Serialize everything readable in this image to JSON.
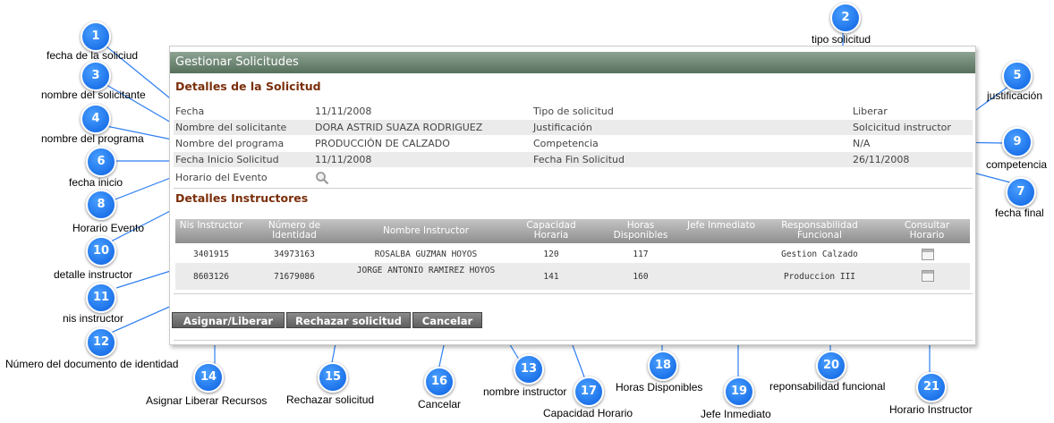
{
  "panel": {
    "title": "Gestionar Solicitudes",
    "request_section": "Detalles de la Solicitud",
    "fields": {
      "fecha_label": "Fecha",
      "fecha_value": "11/11/2008",
      "tipo_label": "Tipo de solicitud",
      "tipo_value": "Liberar",
      "nombre_label": "Nombre del solicitante",
      "nombre_value": "DORA ASTRID SUAZA RODRIGUEZ",
      "justificacion_label": "Justificación",
      "justificacion_value": "Solcicitud instructor",
      "programa_label": "Nombre del programa",
      "programa_value": "PRODUCCIÓN DE CALZADO",
      "competencia_label": "Competencia",
      "competencia_value": "N/A",
      "inicio_label": "Fecha Inicio Solicitud",
      "inicio_value": "11/11/2008",
      "fin_label": "Fecha Fin Solicitud",
      "fin_value": "26/11/2008",
      "horario_label": "Horario del Evento"
    },
    "instructors_section": "Detalles Instructores",
    "table": {
      "headers": [
        "Nis Instructor",
        "Número de Identidad",
        "Nombre Instructor",
        "Capacidad Horaria",
        "Horas Disponibles",
        "Jefe Inmediato",
        "Responsabilidad Funcional",
        "Consultar Horario"
      ],
      "rows": [
        {
          "nis": "3401915",
          "id": "34973163",
          "name": "ROSALBA GUZMAN HOYOS",
          "cap": "120",
          "horas": "117",
          "jefe": "",
          "resp": "Gestion Calzado"
        },
        {
          "nis": "8603126",
          "id": "71679086",
          "name": "JORGE ANTONIO RAMIREZ HOYOS",
          "cap": "141",
          "horas": "160",
          "jefe": "",
          "resp": "Produccion III"
        }
      ]
    },
    "buttons": {
      "assign": "Asignar/Liberar",
      "reject": "Rechazar solicitud",
      "cancel": "Cancelar"
    }
  },
  "callouts": [
    {
      "n": "1",
      "label": "fecha de la soliciud"
    },
    {
      "n": "2",
      "label": "tipo solicitud"
    },
    {
      "n": "3",
      "label": "nombre del solicitante"
    },
    {
      "n": "4",
      "label": "nombre del programa"
    },
    {
      "n": "5",
      "label": "justificación"
    },
    {
      "n": "6",
      "label": "fecha inicio"
    },
    {
      "n": "7",
      "label": "fecha final"
    },
    {
      "n": "8",
      "label": "Horario Evento"
    },
    {
      "n": "9",
      "label": "competencia"
    },
    {
      "n": "10",
      "label": "detalle instructor"
    },
    {
      "n": "11",
      "label": "nis instructor"
    },
    {
      "n": "12",
      "label": "Número del documento de identidad"
    },
    {
      "n": "13",
      "label": "nombre instructor"
    },
    {
      "n": "14",
      "label": "Asignar Liberar Recursos"
    },
    {
      "n": "15",
      "label": "Rechazar solicitud"
    },
    {
      "n": "16",
      "label": "Cancelar"
    },
    {
      "n": "17",
      "label": "Capacidad Horario"
    },
    {
      "n": "18",
      "label": "Horas Disponibles"
    },
    {
      "n": "19",
      "label": "Jefe Inmediato"
    },
    {
      "n": "20",
      "label": "reponsabilidad funcional"
    },
    {
      "n": "21",
      "label": "Horario Instructor"
    }
  ],
  "colors": {
    "badge": "#1f7ef5",
    "header_bar": "#56705c",
    "section_title": "#7a2e0a"
  }
}
